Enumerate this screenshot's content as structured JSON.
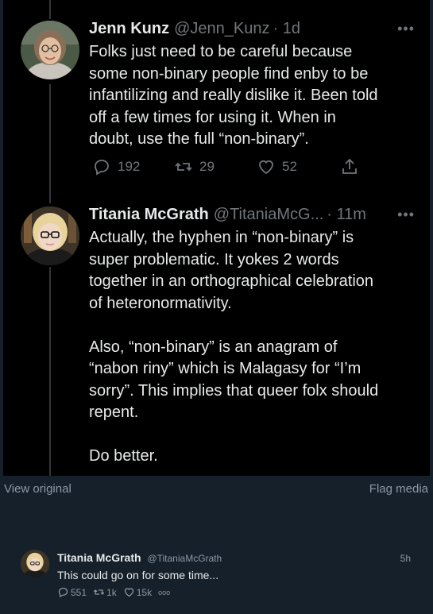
{
  "thread": {
    "tweets": [
      {
        "name": "Jenn Kunz",
        "handle": "@Jenn_Kunz",
        "time": "· 1d",
        "text": "Folks just need to be careful because\nsome non-binary people find enby to be\ninfantilizing and really dislike it. Been told\noff a few times for using it. When in\ndoubt, use the full “non-binary”.",
        "replies": "192",
        "retweets": "29",
        "likes": "52"
      },
      {
        "name": "Titania McGrath",
        "handle": "@TitaniaMcG...",
        "time": "· 11m",
        "text": "Actually, the hyphen in “non-binary” is\nsuper problematic. It yokes 2 words\ntogether in an orthographical celebration\nof heteronormativity.\n\nAlso, “non-binary” is an anagram of\n“nabon riny” which is Malagasy for “I’m\nsorry”. This implies that queer folx should\nrepent.\n\nDo better."
      }
    ]
  },
  "media_links": {
    "view_original": "View original",
    "flag_media": "Flag media"
  },
  "post": {
    "name": "Titania McGrath",
    "handle": "@TitaniaMcGrath",
    "time": "5h",
    "text": "This could go on for some time...",
    "replies": "551",
    "retweets": "1k",
    "likes": "15k",
    "more": "ooo"
  }
}
